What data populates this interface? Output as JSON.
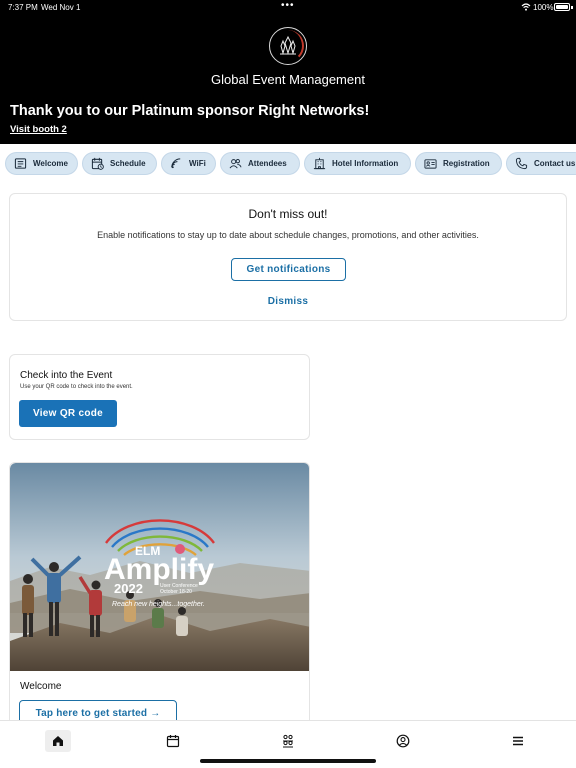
{
  "status_bar": {
    "time": "7:37 PM",
    "date": "Wed Nov 1",
    "dots": "•••",
    "battery": "100%"
  },
  "header": {
    "app_title": "Global Event Management",
    "sponsor_text": "Thank you to our Platinum sponsor Right Networks!",
    "sponsor_link": "Visit booth 2"
  },
  "chips": [
    {
      "label": "Welcome",
      "icon": "welcome-icon"
    },
    {
      "label": "Schedule",
      "icon": "schedule-icon"
    },
    {
      "label": "WiFi",
      "icon": "wifi-icon"
    },
    {
      "label": "Attendees",
      "icon": "attendees-icon"
    },
    {
      "label": "Hotel Information",
      "icon": "hotel-icon"
    },
    {
      "label": "Registration",
      "icon": "registration-icon"
    },
    {
      "label": "Contact us",
      "icon": "phone-icon"
    }
  ],
  "notification": {
    "title": "Don't miss out!",
    "body": "Enable notifications to stay up to date about schedule changes, promotions, and other activities.",
    "primary_button": "Get notifications",
    "dismiss": "Dismiss"
  },
  "checkin": {
    "title": "Check into the Event",
    "subtitle": "Use your QR code to check into the event.",
    "button": "View QR code"
  },
  "welcome_card": {
    "hero": {
      "brand_small": "ELM",
      "brand_big": "Amplify",
      "year": "2022",
      "event_line1": "User Conference",
      "event_line2": "October 18-20",
      "tagline": "Reach new heights...together."
    },
    "label": "Welcome",
    "button": "Tap here to get started →"
  },
  "tabbar": [
    {
      "name": "home",
      "icon": "home-icon",
      "active": true
    },
    {
      "name": "calendar",
      "icon": "calendar-icon",
      "active": false
    },
    {
      "name": "people",
      "icon": "people-icon",
      "active": false
    },
    {
      "name": "profile",
      "icon": "profile-icon",
      "active": false
    },
    {
      "name": "menu",
      "icon": "menu-icon",
      "active": false
    }
  ],
  "colors": {
    "accent": "#1a72b7",
    "chip_bg": "#d7e6f2",
    "header_bg": "#000000"
  }
}
